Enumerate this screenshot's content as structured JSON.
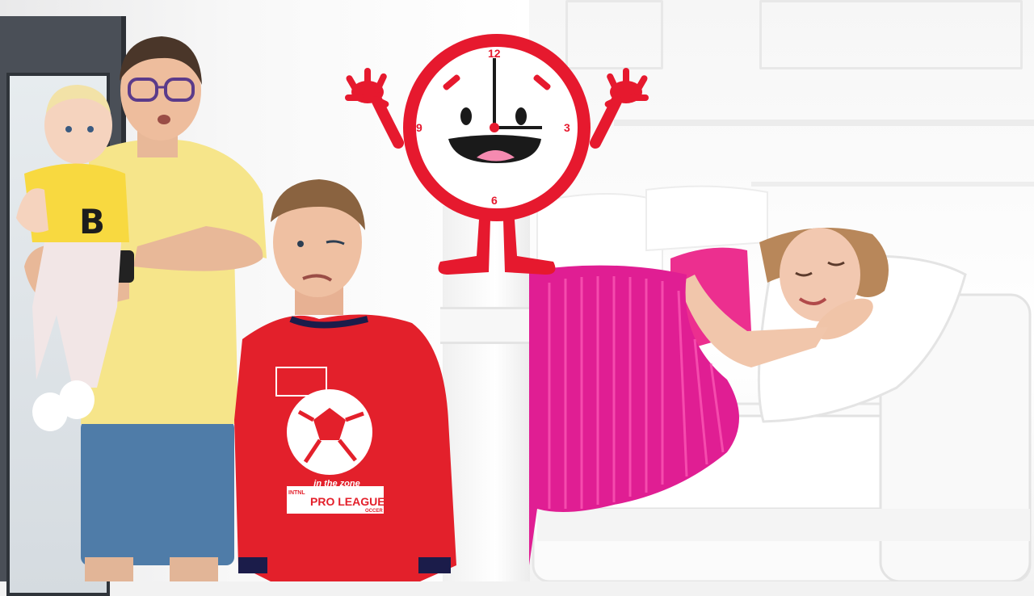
{
  "scene": {
    "colors": {
      "clock_red": "#e6192e",
      "shirt_yellow": "#f6e58a",
      "jersey_red": "#e3202b",
      "blanket_pink": "#e5239a",
      "sofa_white": "#fbfbfb"
    }
  },
  "clock": {
    "numbers": {
      "twelve": "12",
      "three": "3",
      "six": "6",
      "nine": "9"
    }
  },
  "jersey": {
    "line1": "in the zone",
    "line2": "INTNL",
    "line3": "PRO LEAGUE",
    "line4": "OCCER"
  },
  "baby_shirt": {
    "letter": "B"
  }
}
